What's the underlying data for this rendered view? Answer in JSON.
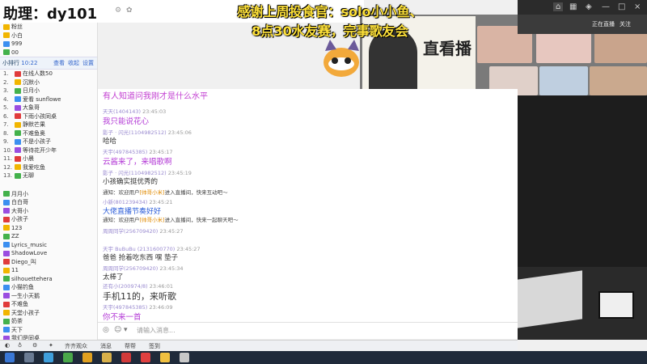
{
  "overlay": {
    "assistant": "助理：dy101367"
  },
  "ticker": {
    "line1": "感谢上周投食官：solo小小鱼、",
    "line2": "8点30水友赛，完事歌友会"
  },
  "sidebar": {
    "top_rows": [
      "粉丝",
      "小白",
      "999",
      "00"
    ],
    "section_head": {
      "label": "小排行",
      "time": "10:22",
      "actions": [
        "查看",
        "收起",
        "设置"
      ]
    },
    "ranks": [
      {
        "rank": "1.",
        "name": "在线人数50"
      },
      {
        "rank": "2.",
        "name": "沉默小"
      },
      {
        "rank": "3.",
        "name": "日月小"
      },
      {
        "rank": "4.",
        "name": "爱看 sunflowe"
      },
      {
        "rank": "5.",
        "name": "大象哥"
      },
      {
        "rank": "6.",
        "name": "下雨小孩同桌"
      },
      {
        "rank": "7.",
        "name": "静默芒果"
      },
      {
        "rank": "8.",
        "name": "不难鱼奥"
      },
      {
        "rank": "9.",
        "name": "不是小孩子"
      },
      {
        "rank": "10.",
        "name": "等待花开少年"
      },
      {
        "rank": "11.",
        "name": "小晨"
      },
      {
        "rank": "12.",
        "name": "我爱吃鱼"
      },
      {
        "rank": "13.",
        "name": "无聊"
      }
    ],
    "fans": [
      "月月小",
      "白白哥",
      "大哥小",
      "小孩子",
      "123",
      "ZZ",
      "Lyrics_music",
      "ShadowLove",
      "Diego_叫",
      "11",
      "silhouettehera",
      "小猫钓鱼",
      "一生小天鹅",
      "不难鱼",
      "天堂小孩子",
      "奶茶",
      "天下",
      "我们是同桌"
    ]
  },
  "chat": {
    "top_line": "有人知道问我刚才是什么水平",
    "messages": [
      {
        "meta_name": "天天(1404143)",
        "meta_time": "23:45:03",
        "text": "我只能说花心",
        "style": "purple"
      },
      {
        "meta_name": "影子 · 闪光(1104982512)",
        "meta_time": "23:45:06",
        "text": "哈哈",
        "style": ""
      },
      {
        "meta_name": "天宇(497845385)",
        "meta_time": "23:45:17",
        "text": "云酱来了，来唱歌啊",
        "style": "purple"
      },
      {
        "meta_name": "影子 · 闪光(1104982512)",
        "meta_time": "23:45:19",
        "text": "小孩确实挺优秀的",
        "style": ""
      }
    ],
    "sys1": {
      "text": "通知：欢迎用户",
      "hl": "[帅哥小米]",
      "rest": "进入直播间，快来互动吧～"
    },
    "msg5": {
      "meta_name": "小新(801239434)",
      "meta_time": "23:45:21",
      "text": "大佬直播节奏好好",
      "style": "blue"
    },
    "sys2": {
      "text": "通知：欢迎用户",
      "hl": "[帅哥小米]",
      "rest": "进入直播间，快来一起聊天吧～"
    },
    "msg6": {
      "meta_name": "周周同学(256709420)",
      "meta_time": "23:45:27",
      "text": "",
      "style": ""
    },
    "msg7": {
      "meta_name": "天宇 BuBuBu (2131600770)",
      "meta_time": "23:45:27",
      "text": "爸爸 抢着吃东西    嘿  垫子",
      "style": ""
    },
    "msg8": {
      "meta_name": "周周同学(256709420)",
      "meta_time": "23:45:34",
      "text": "太棒了",
      "style": ""
    },
    "msg9": {
      "meta_name": "还有小(200974/8)",
      "meta_time": "23:46:01",
      "text": "手机11的，来听歌",
      "style": "big"
    },
    "msg10": {
      "meta_name": "天宇(497845385)",
      "meta_time": "23:46:09",
      "text": "你不来一首",
      "style": "purple"
    },
    "input_placeholder": "请输入消息..."
  },
  "video": {
    "art_text": "直看播",
    "cam_labels": [
      "正在直播",
      "关注"
    ],
    "window_buttons": [
      "—",
      "□",
      "×"
    ]
  },
  "tray": {
    "items": [
      "齐齐观众",
      "消息",
      "帮帮",
      "签到"
    ]
  },
  "taskbar": {
    "icons": [
      "start-icon",
      "search-icon",
      "task-view-icon",
      "browser-icon",
      "chat-app-icon",
      "folder-icon",
      "media-icon",
      "game-icon",
      "livestream-icon",
      "tool-icon"
    ]
  },
  "colors": {
    "accent_purple": "#b33ad6",
    "ticker_yellow": "#ffe23a",
    "taskbar": "#1f2a3a"
  }
}
